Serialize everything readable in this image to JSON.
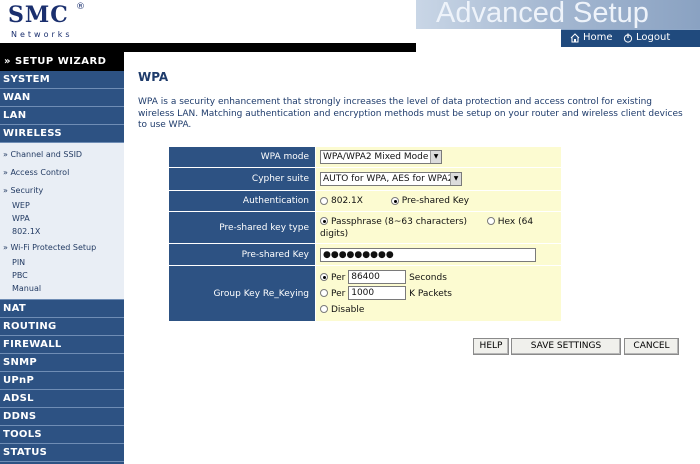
{
  "header": {
    "logo": "SMC",
    "logo_reg": "®",
    "logo_sub": "Networks",
    "banner": "Advanced Setup",
    "nav": {
      "home": "Home",
      "logout": "Logout"
    }
  },
  "sidebar": {
    "wizard": "» SETUP WIZARD",
    "system": "SYSTEM",
    "wan": "WAN",
    "lan": "LAN",
    "wireless": "WIRELESS",
    "wireless_sub": [
      {
        "label": "» Channel and SSID"
      },
      {
        "label": "» Access Control"
      },
      {
        "label": "» Security"
      },
      {
        "label": "WEP"
      },
      {
        "label": "WPA"
      },
      {
        "label": "802.1X"
      },
      {
        "label": "» Wi-Fi Protected Setup"
      },
      {
        "label": "PIN"
      },
      {
        "label": "PBC"
      },
      {
        "label": "Manual"
      }
    ],
    "bottom": [
      {
        "label": "NAT"
      },
      {
        "label": "ROUTING"
      },
      {
        "label": "FIREWALL"
      },
      {
        "label": "SNMP"
      },
      {
        "label": "UPnP"
      },
      {
        "label": "ADSL"
      },
      {
        "label": "DDNS"
      },
      {
        "label": "TOOLS"
      },
      {
        "label": "STATUS"
      }
    ]
  },
  "main": {
    "title": "WPA",
    "description": "WPA is a security enhancement that strongly increases the level of data protection and access control for existing wireless LAN. Matching authentication and encryption methods must be setup on your router and wireless client devices to use WPA.",
    "form": {
      "wpa_mode_label": "WPA mode",
      "wpa_mode_value": "WPA/WPA2 Mixed Mode",
      "cypher_label": "Cypher suite",
      "cypher_value": "AUTO for WPA, AES for WPA2",
      "auth_label": "Authentication",
      "auth_opt1": "802.1X",
      "auth_opt2": "Pre-shared Key",
      "psk_type_label": "Pre-shared key type",
      "psk_type_opt1": "Passphrase (8~63 characters)",
      "psk_type_opt2": "Hex (64 digits)",
      "psk_label": "Pre-shared Key",
      "psk_value": "●●●●●●●●●",
      "regroup_label": "Group Key Re_Keying",
      "per_label": "Per",
      "per_seconds_value": "86400",
      "seconds_unit": "Seconds",
      "per_packets_value": "1000",
      "packets_unit": "K Packets",
      "disable_label": "Disable"
    },
    "buttons": {
      "help": "HELP",
      "save": "SAVE SETTINGS",
      "cancel": "CANCEL"
    }
  },
  "colors": {
    "sidebar_bg": "#2d5283",
    "label_bg": "#2d5283",
    "value_bg": "#fcfbd1",
    "title": "#1e3b6b"
  }
}
